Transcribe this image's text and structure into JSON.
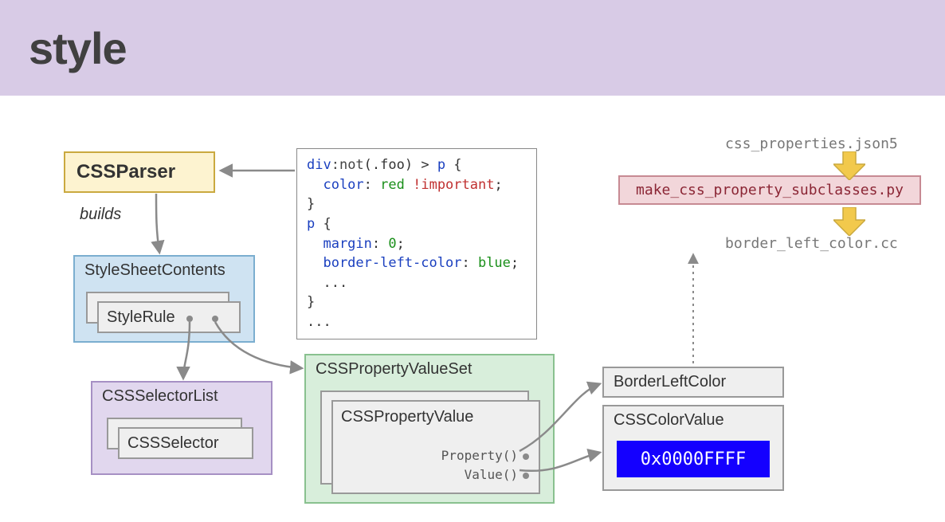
{
  "header": {
    "title": "style"
  },
  "labels": {
    "builds": "builds",
    "cssparser": "CSSParser",
    "stylesheet": "StyleSheetContents",
    "stylerule": "StyleRule",
    "selectorlist": "CSSSelectorList",
    "cssselector": "CSSSelector",
    "valueset": "CSSPropertyValueSet",
    "propvalue": "CSSPropertyValue",
    "prop_method": "Property()",
    "value_method": "Value()",
    "borderleft": "BorderLeftColor",
    "colorvalue": "CSSColorValue",
    "hex": "0x0000FFFF"
  },
  "code": {
    "l1_sel1": "div",
    "l1_pseudo": ":not",
    "l1_paren": "(.foo)",
    "l1_comb": " > ",
    "l1_sel2": "p",
    "l1_brace": " {",
    "l2_prop": "  color",
    "l2_colon": ": ",
    "l2_val": "red",
    "l2_sp": " ",
    "l2_imp": "!important",
    "l2_semi": ";",
    "l3": "}",
    "l4_sel": "p",
    "l4_brace": " {",
    "l5_prop": "  margin",
    "l5_colon": ": ",
    "l5_val": "0",
    "l5_semi": ";",
    "l6_prop": "  border-left-color",
    "l6_colon": ": ",
    "l6_val": "blue",
    "l6_semi": ";",
    "l7": "  ...",
    "l8": "}",
    "l9": "..."
  },
  "gen": {
    "input": "css_properties.json5",
    "script": "make_css_property_subclasses.py",
    "output": "border_left_color.cc"
  }
}
